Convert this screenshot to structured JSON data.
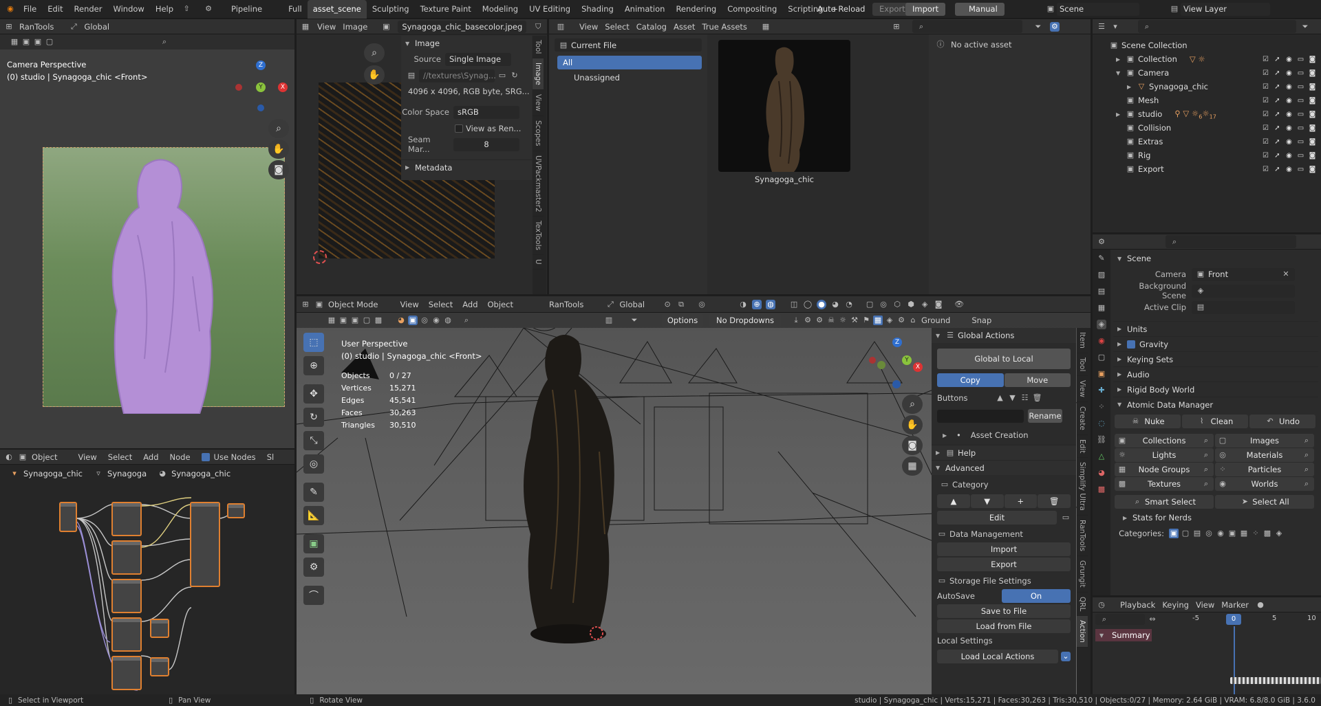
{
  "topbar": {
    "menus": [
      "File",
      "Edit",
      "Render",
      "Window",
      "Help"
    ],
    "pipeline": "Pipeline",
    "workspaces": [
      "Full",
      "asset_scene",
      "Sculpting",
      "Texture Paint",
      "Modeling",
      "UV Editing",
      "Shading",
      "Animation",
      "Rendering",
      "Compositing",
      "Scripting"
    ],
    "active_workspace": "asset_scene",
    "add_tab": "+",
    "auto_reload": "Auto Reload",
    "export": "Export",
    "import": "Import",
    "manual": "Manual",
    "scene": "Scene",
    "view_layer": "View Layer"
  },
  "camera_view": {
    "toolbar": {
      "rantools": "RanTools",
      "global": "Global"
    },
    "title": "Camera Perspective",
    "subtitle": "(0) studio | Synagoga_chic <Front>",
    "gizmo": {
      "x": "X",
      "y": "Y",
      "z": "Z"
    }
  },
  "image_editor": {
    "menus": [
      "View",
      "Image"
    ],
    "image_name": "Synagoga_chic_basecolor.jpeg",
    "panel_title": "Image",
    "source_label": "Source",
    "source_value": "Single Image",
    "path": "//textures\\Synag...",
    "info": "4096 x 4096,  RGB byte,  SRG...",
    "color_space_label": "Color Space",
    "color_space_value": "sRGB",
    "view_as_render": "View as Ren...",
    "seam_label": "Seam Mar...",
    "seam_value": "8",
    "metadata": "Metadata",
    "side_tabs": [
      "Tool",
      "Image",
      "View",
      "Scopes",
      "UVPackmaster2",
      "TexTools",
      "U"
    ]
  },
  "asset_browser": {
    "menus": [
      "View",
      "Select",
      "Catalog",
      "Asset",
      "True Assets"
    ],
    "library": "Current File",
    "catalogs": [
      "All",
      "Unassigned"
    ],
    "asset_name": "Synagoga_chic",
    "no_active": "No active asset"
  },
  "outliner": {
    "root": "Scene Collection",
    "items": [
      {
        "label": "Collection",
        "indent": 1,
        "tri": "▶"
      },
      {
        "label": "Camera",
        "indent": 1,
        "tri": "▼"
      },
      {
        "label": "Synagoga_chic",
        "indent": 2,
        "tri": "▶"
      },
      {
        "label": "Mesh",
        "indent": 1,
        "tri": ""
      },
      {
        "label": "studio",
        "indent": 1,
        "tri": "▶",
        "badge1": "6",
        "badge2": "17"
      },
      {
        "label": "Collision",
        "indent": 1,
        "tri": ""
      },
      {
        "label": "Extras",
        "indent": 1,
        "tri": ""
      },
      {
        "label": "Rig",
        "indent": 1,
        "tri": ""
      },
      {
        "label": "Export",
        "indent": 1,
        "tri": ""
      }
    ]
  },
  "properties": {
    "scene_title": "Scene",
    "camera_label": "Camera",
    "camera_value": "Front",
    "bg_scene_label": "Background Scene",
    "active_clip_label": "Active Clip",
    "sections": [
      "Units",
      "Gravity",
      "Keying Sets",
      "Audio",
      "Rigid Body World"
    ],
    "adm_title": "Atomic Data Manager",
    "nuke": "Nuke",
    "clean": "Clean",
    "undo": "Undo",
    "grid": [
      [
        "Collections",
        "Images"
      ],
      [
        "Lights",
        "Materials"
      ],
      [
        "Node Groups",
        "Particles"
      ],
      [
        "Textures",
        "Worlds"
      ]
    ],
    "smart_select": "Smart Select",
    "select_all": "Select All",
    "stats": "Stats for Nerds",
    "categories": "Categories:"
  },
  "timeline": {
    "menus": [
      "Playback",
      "Keying",
      "View",
      "Marker"
    ],
    "ticks": [
      "-5",
      "0",
      "5",
      "10"
    ],
    "current": "0",
    "summary": "Summary"
  },
  "node_editor": {
    "mode": "Object",
    "menus": [
      "View",
      "Select",
      "Add",
      "Node"
    ],
    "use_nodes": "Use Nodes",
    "sl": "Sl",
    "breadcrumb": [
      "Synagoga_chic",
      "Synagoga",
      "Synagoga_chic"
    ]
  },
  "viewport": {
    "mode": "Object Mode",
    "menus": [
      "View",
      "Select",
      "Add",
      "Object"
    ],
    "rantools": "RanTools",
    "global": "Global",
    "options": "Options",
    "no_dropdowns": "No Dropdowns",
    "ground": "Ground",
    "snap": "Snap",
    "title": "User Perspective",
    "subtitle": "(0) studio | Synagoga_chic <Front>",
    "stats": [
      {
        "label": "Objects",
        "value": "0 / 27"
      },
      {
        "label": "Vertices",
        "value": "15,271"
      },
      {
        "label": "Edges",
        "value": "45,541"
      },
      {
        "label": "Faces",
        "value": "30,263"
      },
      {
        "label": "Triangles",
        "value": "30,510"
      }
    ],
    "gizmo": {
      "x": "X",
      "y": "Y",
      "z": "Z"
    }
  },
  "npanel": {
    "global_actions": "Global Actions",
    "global_to_local": "Global to Local",
    "copy": "Copy",
    "move": "Move",
    "buttons": "Buttons",
    "rename": "Rename",
    "asset_creation": "Asset Creation",
    "help": "Help",
    "advanced": "Advanced",
    "category": "Category",
    "edit": "Edit",
    "data_management": "Data Management",
    "import": "Import",
    "export": "Export",
    "storage": "Storage File Settings",
    "autosave": "AutoSave",
    "autosave_value": "On",
    "save_to_file": "Save to File",
    "load_from_file": "Load from File",
    "local_settings": "Local Settings",
    "load_local": "Load Local Actions",
    "tabs": [
      "Item",
      "Tool",
      "View",
      "Create",
      "Edit",
      "Simplify Ultra",
      "RanTools",
      "Grungit",
      "QRL",
      "Action"
    ]
  },
  "statusbar": {
    "left1": "Select in Viewport",
    "left2": "Pan View",
    "left3": "Rotate View",
    "right": "studio | Synagoga_chic | Verts:15,271 | Faces:30,263 | Tris:30,510 | Objects:0/27 | Memory: 2.64 GiB | VRAM: 6.8/8.0 GiB | 3.6.0"
  }
}
